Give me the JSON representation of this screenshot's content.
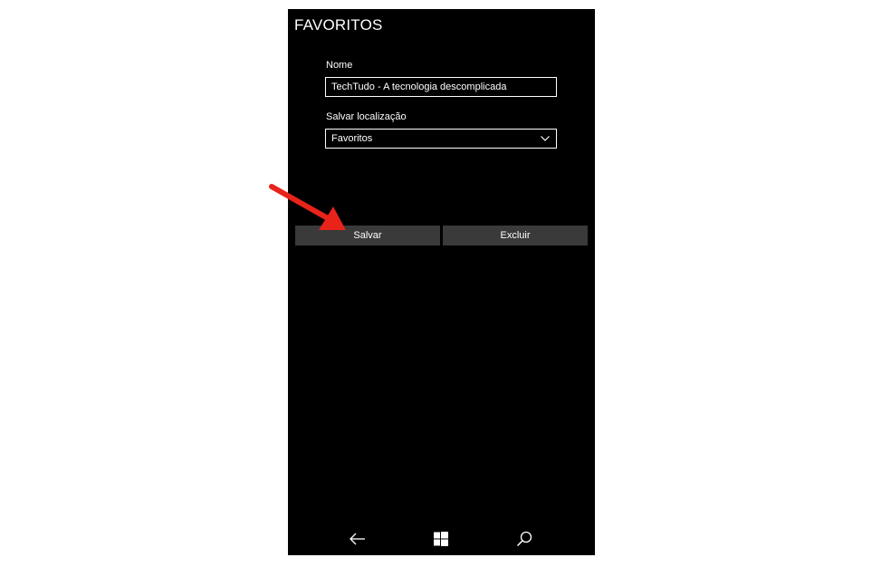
{
  "header": {
    "title": "FAVORITOS"
  },
  "form": {
    "name_label": "Nome",
    "name_value": "TechTudo - A tecnologia descomplicada",
    "location_label": "Salvar localização",
    "location_selected": "Favoritos"
  },
  "actions": {
    "save_label": "Salvar",
    "delete_label": "Excluir"
  },
  "navbar": {
    "icons": [
      "back-arrow-icon",
      "windows-icon",
      "search-icon"
    ]
  },
  "colors": {
    "background": "#000000",
    "button": "#3a3a3a",
    "text": "#ffffff",
    "annotation_arrow": "#e8231a"
  }
}
